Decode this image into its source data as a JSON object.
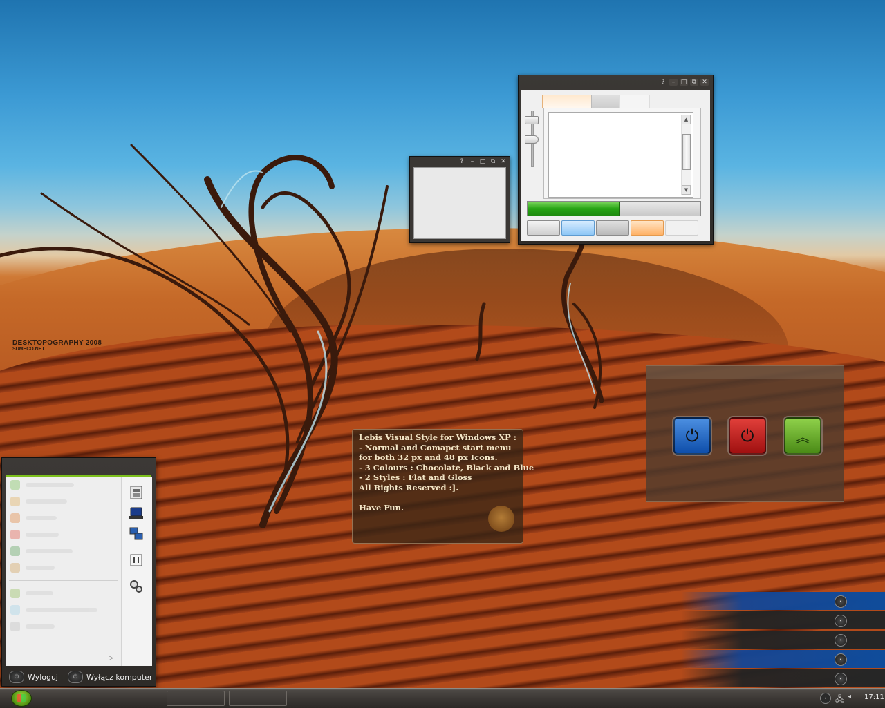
{
  "wallpaper": {
    "logo_title": "DESKTOPOGRAPHY 2008",
    "logo_subtitle": "SUMECO.NET"
  },
  "small_window": {
    "help": "?",
    "minimize": "–",
    "maximize": "□",
    "restore": "⧉",
    "close": "✕"
  },
  "big_window": {
    "help": "?",
    "minimize": "–",
    "maximize": "□",
    "restore": "⧉",
    "close": "✕",
    "progress_fraction": 0.53
  },
  "info_box": {
    "lines": [
      "Lebis Visual Style for Windows XP :",
      "- Normal and Comapct start menu",
      "for both 32 px and 48 px Icons.",
      "- 3 Colours : Chocolate, Black and Blue",
      "- 2 Styles : Flat and Gloss",
      "All Rights Reserved :]."
    ],
    "footer": "Have Fun."
  },
  "shutdown_panel": {
    "buttons": [
      "standby",
      "power",
      "hibernate"
    ]
  },
  "start_menu": {
    "logoff_label": "Wyloguj",
    "shutdown_label": "Wyłącz komputer"
  },
  "taskbar": {
    "clock": "17:11"
  },
  "colors": {
    "accent_green": "#7cc01c",
    "progress_green": "#27a414",
    "shutdown_blue": "#0e4eaa",
    "shutdown_red": "#9f1010",
    "shutdown_green": "#4a8a16"
  }
}
